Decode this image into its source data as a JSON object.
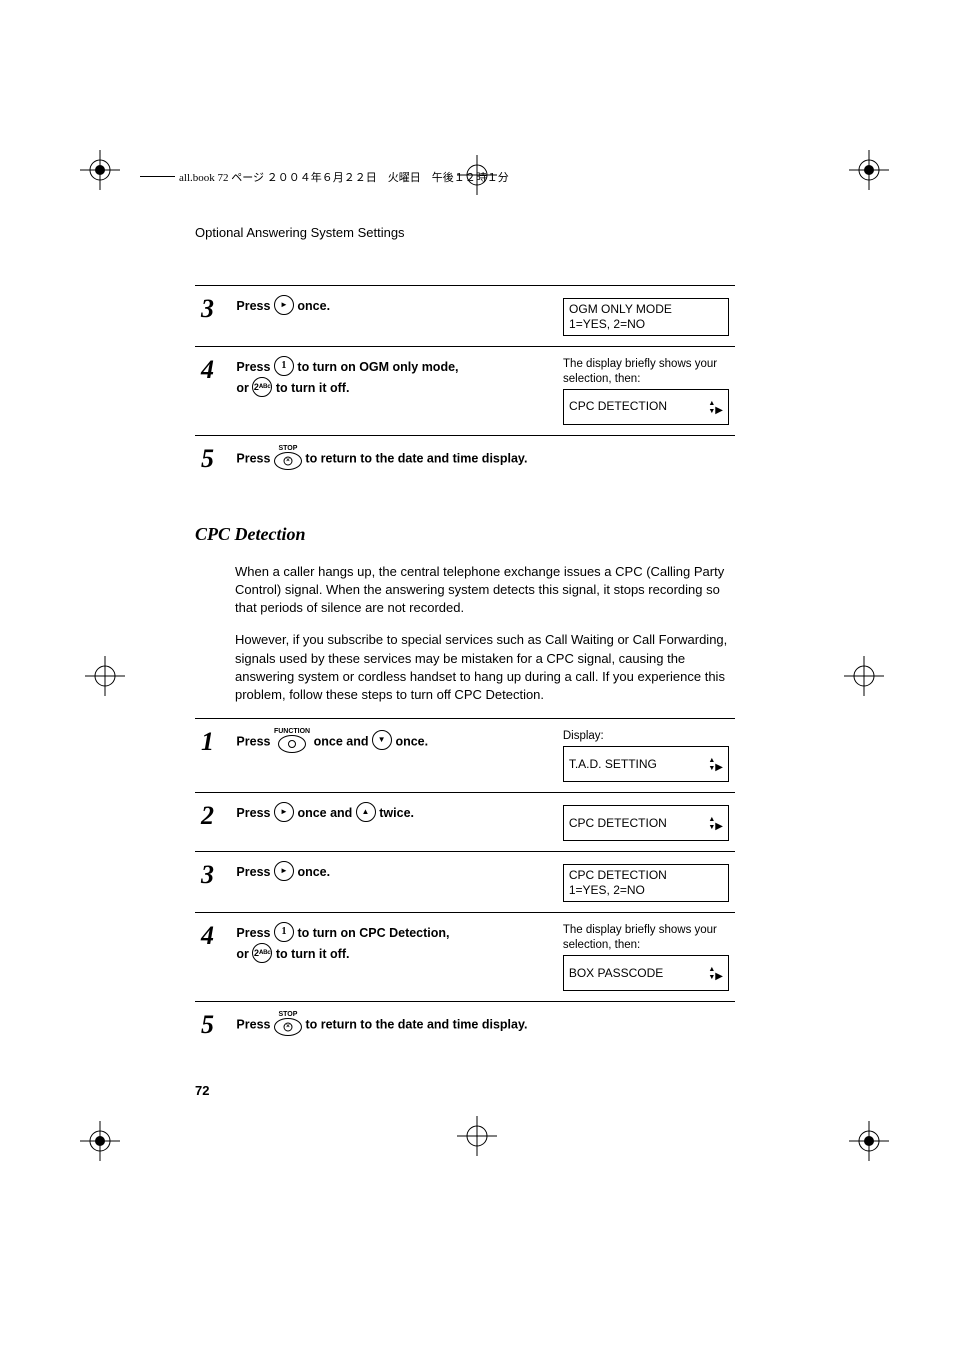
{
  "header": {
    "text": "all.book  72 ページ  ２００４年６月２２日　火曜日　午後１２時１分"
  },
  "runningHead": "Optional Answering System Settings",
  "stepsA": {
    "s3": {
      "num": "3",
      "pre": "Press ",
      "post": " once.",
      "lcd": "OGM ONLY MODE\n1=YES, 2=NO"
    },
    "s4": {
      "num": "4",
      "pre": "Press ",
      "mid": " to turn on OGM only mode,",
      "or": "or ",
      "post": " to turn it off.",
      "note": "The display briefly shows your selection, then:",
      "lcd": "CPC DETECTION"
    },
    "s5": {
      "num": "5",
      "pre": "Press ",
      "post": " to return to the date and time display.",
      "stopLabel": "STOP"
    }
  },
  "section": {
    "title": "CPC Detection",
    "p1": "When a caller hangs up, the central telephone exchange issues a CPC (Calling Party Control) signal. When the answering system detects this signal, it stops recording so that periods of silence are not recorded.",
    "p2": "However, if you subscribe to special services such as Call Waiting or Call Forwarding, signals used by these services may be mistaken for a CPC signal, causing the answering system or cordless handset to hang up during a call. If you experience this problem, follow these steps to turn off CPC Detection."
  },
  "stepsB": {
    "dispLabel": "Display:",
    "s1": {
      "num": "1",
      "pre": "Press ",
      "funcLabel": "FUNCTION",
      "mid": " once and ",
      "post": " once.",
      "lcd": "T.A.D. SETTING"
    },
    "s2": {
      "num": "2",
      "pre": "Press ",
      "mid": " once and ",
      "post": " twice.",
      "lcd": "CPC DETECTION"
    },
    "s3": {
      "num": "3",
      "pre": "Press ",
      "post": " once.",
      "lcd": "CPC DETECTION\n1=YES, 2=NO"
    },
    "s4": {
      "num": "4",
      "pre": "Press ",
      "mid": " to turn on CPC Detection,",
      "or": "or ",
      "post": " to turn it off.",
      "note": "The display briefly shows your selection, then:",
      "lcd": "BOX PASSCODE"
    },
    "s5": {
      "num": "5",
      "pre": "Press ",
      "post": " to return to the date and time display.",
      "stopLabel": "STOP"
    }
  },
  "keys": {
    "num1": "1",
    "num2": "2ᴬᴮᶜ"
  },
  "pageNum": "72"
}
